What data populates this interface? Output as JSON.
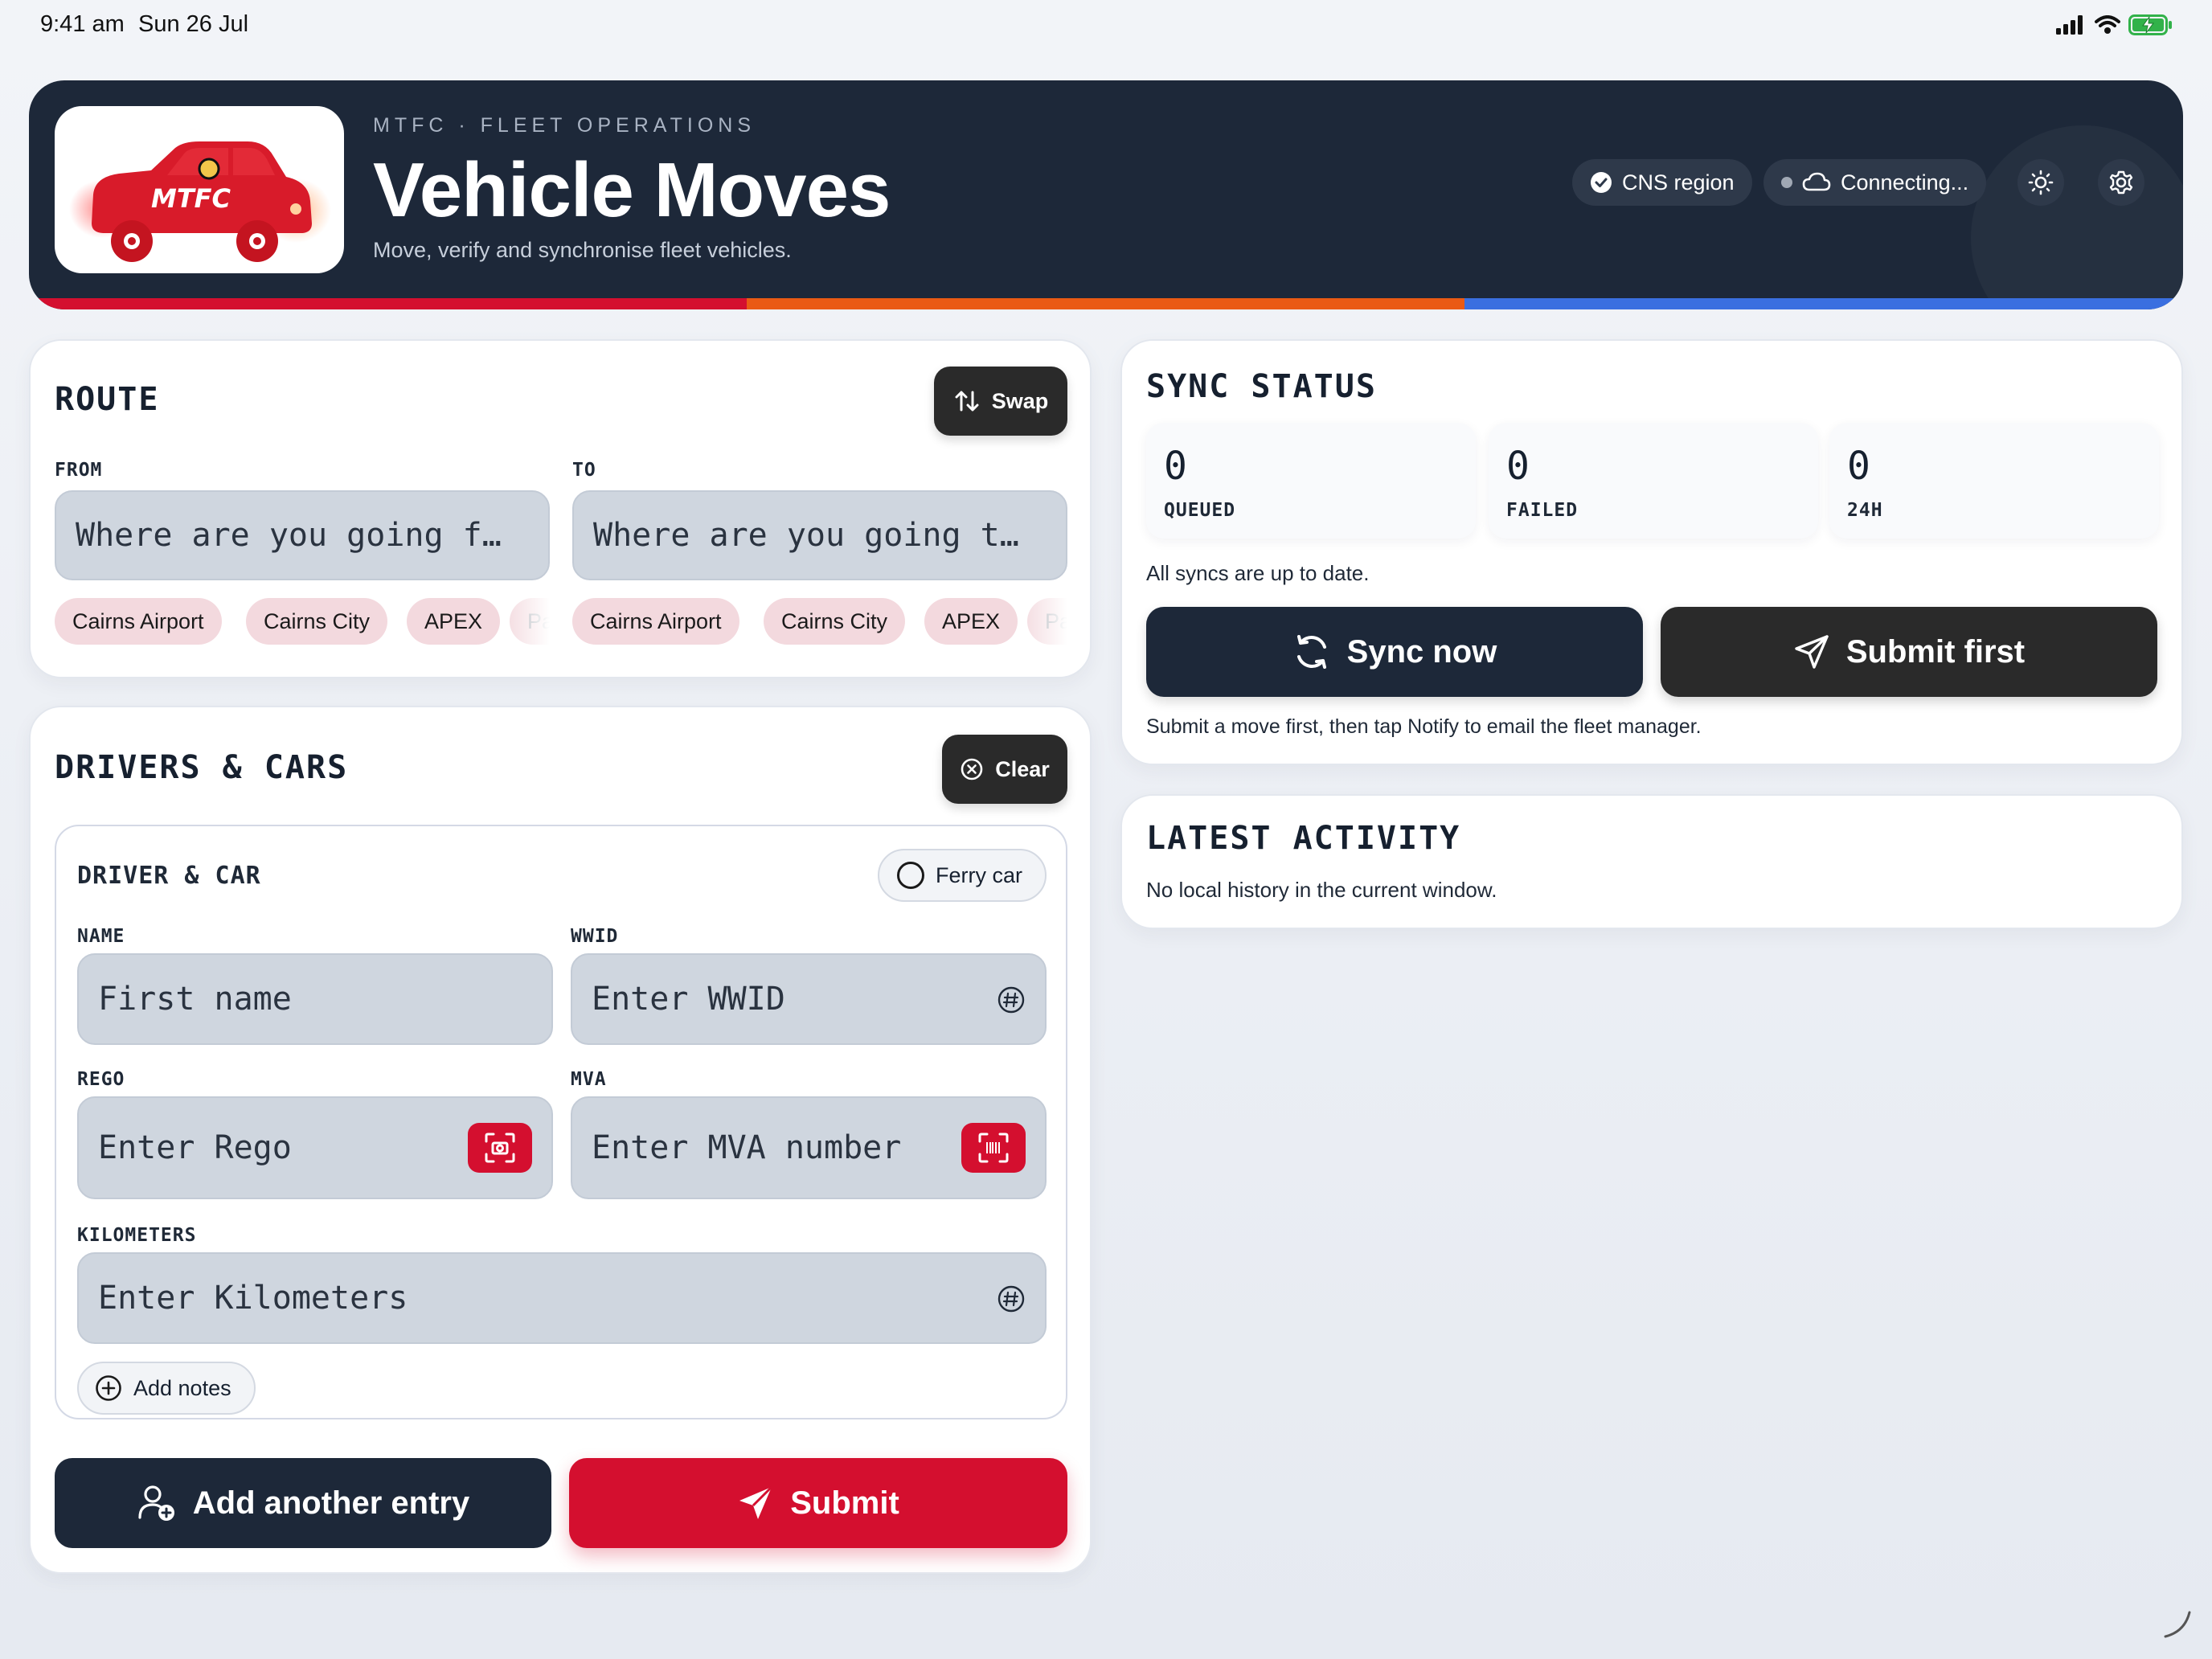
{
  "status_bar": {
    "time": "9:41 am",
    "date": "Sun 26 Jul"
  },
  "header": {
    "logo_text": "MTFC",
    "kicker": "MTFC · FLEET OPERATIONS",
    "title": "Vehicle Moves",
    "subtitle": "Move, verify and synchronise fleet vehicles.",
    "region_label": "CNS region",
    "connection_label": "Connecting...",
    "stripe_colors": [
      "#d40f2f",
      "#ea5a14",
      "#3a6fe0"
    ]
  },
  "route": {
    "title": "ROUTE",
    "swap_label": "Swap",
    "from_label": "FROM",
    "to_label": "TO",
    "from_placeholder": "Where are you going f…",
    "to_placeholder": "Where are you going t…",
    "from_chips": [
      "Cairns Airport",
      "Cairns City",
      "APEX",
      "Pa"
    ],
    "to_chips": [
      "Cairns Airport",
      "Cairns City",
      "APEX",
      "Pa"
    ]
  },
  "drivers": {
    "title": "DRIVERS & CARS",
    "clear_label": "Clear",
    "entry_title": "DRIVER & CAR",
    "ferry_label": "Ferry car",
    "name_label": "NAME",
    "name_placeholder": "First name",
    "wwid_label": "WWID",
    "wwid_placeholder": "Enter WWID",
    "rego_label": "REGO",
    "rego_placeholder": "Enter Rego",
    "mva_label": "MVA",
    "mva_placeholder": "Enter MVA number",
    "km_label": "KILOMETERS",
    "km_placeholder": "Enter Kilometers",
    "notes_label": "Add notes",
    "add_entry_label": "Add another entry",
    "submit_label": "Submit"
  },
  "sync": {
    "title": "SYNC STATUS",
    "stats": [
      {
        "value": "0",
        "label": "QUEUED"
      },
      {
        "value": "0",
        "label": "FAILED"
      },
      {
        "value": "0",
        "label": "24H"
      }
    ],
    "status_text": "All syncs are up to date.",
    "sync_now_label": "Sync now",
    "submit_first_label": "Submit first",
    "hint": "Submit a move first, then tap Notify to email the fleet manager."
  },
  "activity": {
    "title": "LATEST ACTIVITY",
    "empty_text": "No local history in the current window."
  },
  "colors": {
    "navy": "#1d2839",
    "brand_red": "#d40f2f",
    "chip_bg": "#f3d9de",
    "input_bg": "#cfd6df"
  }
}
